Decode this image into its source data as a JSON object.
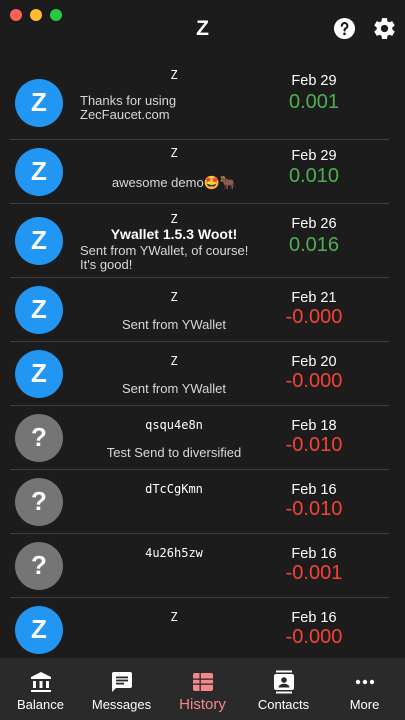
{
  "window": {
    "title": "Z"
  },
  "colors": {
    "positive": "#4caf50",
    "negative": "#f44336",
    "avatar_blue": "#2196f3",
    "avatar_grey": "#757575",
    "active_tab": "#f4878a"
  },
  "header": {
    "help_icon": "help-circle-icon",
    "settings_icon": "gear-icon"
  },
  "transactions": [
    {
      "avatar": "Z",
      "name": "Z",
      "memo1": "Thanks for using",
      "memo2": "ZecFaucet.com",
      "date": "Feb 29",
      "amount": "0.001"
    },
    {
      "avatar": "Z",
      "name": "Z",
      "memo1": "awesome demo🤩🐂",
      "date": "Feb 29",
      "amount": "0.010"
    },
    {
      "avatar": "Z",
      "name": "Z",
      "headline": "Ywallet 1.5.3 Woot!",
      "memo1": "Sent from YWallet, of course!",
      "memo2": "It's good!",
      "date": "Feb 26",
      "amount": "0.016"
    },
    {
      "avatar": "Z",
      "name": "Z",
      "memo1": "Sent from YWallet",
      "date": "Feb 21",
      "amount": "-0.000"
    },
    {
      "avatar": "Z",
      "name": "Z",
      "memo1": "Sent from YWallet",
      "date": "Feb 20",
      "amount": "-0.000"
    },
    {
      "avatar": "?",
      "name": "qsqu4e8n",
      "memo1": "Test Send to diversified",
      "date": "Feb 18",
      "amount": "-0.010"
    },
    {
      "avatar": "?",
      "name": "dTcCgKmn",
      "date": "Feb 16",
      "amount": "-0.010"
    },
    {
      "avatar": "?",
      "name": "4u26h5zw",
      "date": "Feb 16",
      "amount": "-0.001"
    },
    {
      "avatar": "Z",
      "name": "Z",
      "date": "Feb 16",
      "amount": "-0.000"
    }
  ],
  "bottom_nav": [
    {
      "label": "Balance",
      "icon": "bank-icon"
    },
    {
      "label": "Messages",
      "icon": "message-icon"
    },
    {
      "label": "History",
      "icon": "history-table-icon",
      "active": true
    },
    {
      "label": "Contacts",
      "icon": "contacts-icon"
    },
    {
      "label": "More",
      "icon": "more-dots-icon"
    }
  ]
}
